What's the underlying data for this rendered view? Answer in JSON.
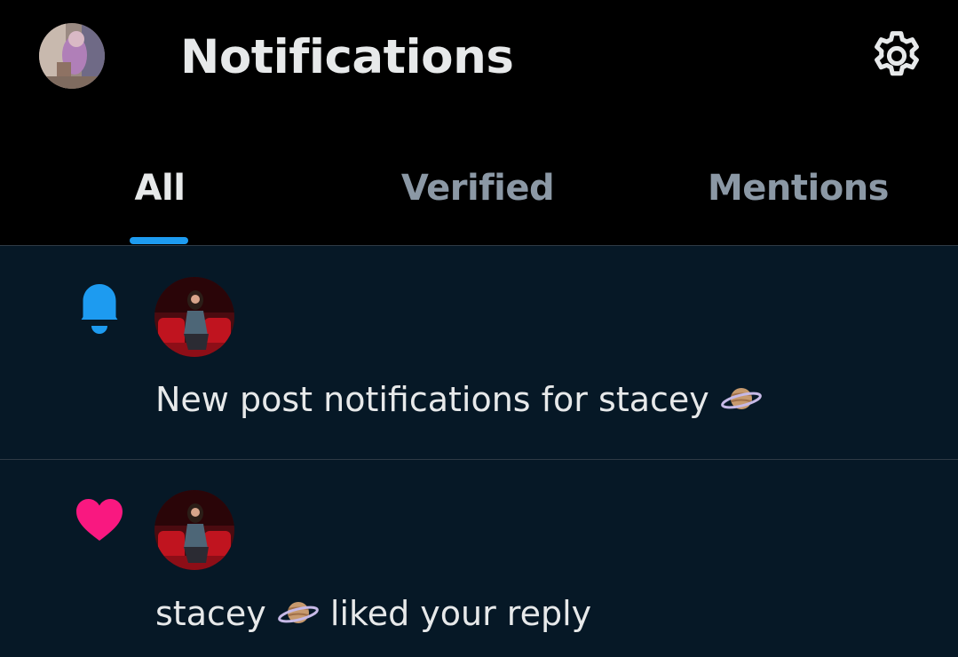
{
  "colors": {
    "header_bg": "#000000",
    "list_bg": "#061826",
    "text_primary": "#e7e9ea",
    "text_secondary": "#8b98a5",
    "accent": "#1d9bf0",
    "like": "#f91880",
    "divider": "#2f3a44"
  },
  "header": {
    "title": "Notifications",
    "avatar_icon": "profile-avatar",
    "settings_icon": "gear-icon"
  },
  "tabs": [
    {
      "label": "All",
      "active": true
    },
    {
      "label": "Verified",
      "active": false
    },
    {
      "label": "Mentions",
      "active": false
    }
  ],
  "notifications": [
    {
      "type_icon": "bell-icon",
      "avatar": "user-avatar-stacey",
      "text_prefix": "New post notifications for ",
      "user_name": "stacey",
      "user_emoji": "ringed-planet-emoji",
      "text_suffix": ""
    },
    {
      "type_icon": "heart-icon",
      "avatar": "user-avatar-stacey",
      "text_prefix": "",
      "user_name": "stacey",
      "user_emoji": "ringed-planet-emoji",
      "text_suffix": " liked your reply"
    }
  ]
}
